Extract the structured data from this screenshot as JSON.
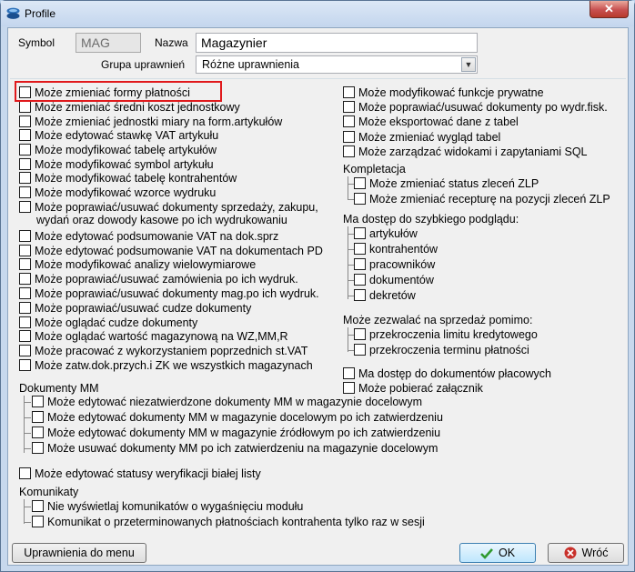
{
  "window": {
    "title": "Profile",
    "close_label": "✕"
  },
  "header": {
    "symbol_label": "Symbol",
    "symbol_value": "MAG",
    "name_label": "Nazwa",
    "name_value": "Magazynier",
    "group_label": "Grupa uprawnień",
    "group_value": "Różne uprawnienia"
  },
  "left_permissions": [
    "Może zmieniać formy płatności",
    "Może zmieniać średni koszt jednostkowy",
    "Może zmieniać jednostki miary na form.artykułów",
    "Może edytować stawkę VAT artykułu",
    "Może modyfikować tabelę artykułów",
    "Może modyfikować symbol artykułu",
    "Może modyfikować tabelę kontrahentów",
    "Może modyfikować wzorce wydruku",
    "Może poprawiać/usuwać dokumenty sprzedaży, zakupu,",
    "Może edytować podsumowanie VAT na dok.sprz",
    "Może edytować podsumowanie VAT na dokumentach PD",
    "Może modyfikować analizy wielowymiarowe",
    "Może poprawiać/usuwać zamówienia po ich wydruk.",
    "Może poprawiać/usuwać dokumenty mag.po ich wydruk.",
    "Może poprawiać/usuwać cudze dokumenty",
    "Może oglądać cudze dokumenty",
    "Może oglądać wartość magazynową na WZ,MM,R",
    "Może pracować z wykorzystaniem poprzednich st.VAT",
    "Może zatw.dok.przych.i ZK we wszystkich magazynach"
  ],
  "left_continuation": "wydań oraz dowody kasowe po ich wydrukowaniu",
  "dokumenty_mm": {
    "title": "Dokumenty MM",
    "items": [
      "Może edytować niezatwierdzone dokumenty MM w magazynie docelowym",
      "Może edytować dokumenty MM w magazynie docelowym po ich zatwierdzeniu",
      "Może edytować dokumenty MM w magazynie źródłowym po ich zatwierdzeniu",
      "Może usuwać dokumenty MM po ich zatwierdzeniu na magazynie docelowym"
    ]
  },
  "white_list": "Może edytować statusy weryfikacji białej listy",
  "komunikaty": {
    "title": "Komunikaty",
    "items": [
      "Nie wyświetlaj komunikatów o wygaśnięciu modułu",
      "Komunikat o przeterminowanych płatnościach kontrahenta tylko raz w sesji"
    ]
  },
  "right_permissions": [
    "Może modyfikować funkcje prywatne",
    "Może poprawiać/usuwać dokumenty po wydr.fisk.",
    "Może eksportować dane z tabel",
    "Może zmieniać wygląd tabel",
    "Może zarządzać widokami i zapytaniami SQL"
  ],
  "kompletacja": {
    "title": "Kompletacja",
    "items": [
      "Może zmieniać status zleceń ZLP",
      "Może zmieniać recepturę na pozycji zleceń ZLP"
    ]
  },
  "podglad": {
    "title": "Ma dostęp do szybkiego podglądu:",
    "items": [
      "artykułów",
      "kontrahentów",
      "pracowników",
      "dokumentów",
      "dekretów"
    ]
  },
  "sprzedaz": {
    "title": "Może zezwalać na sprzedaż pomimo:",
    "items": [
      "przekroczenia limitu kredytowego",
      "przekroczenia terminu płatności"
    ]
  },
  "right_bottom": [
    "Ma dostęp do dokumentów płacowych",
    "Może pobierać załącznik"
  ],
  "footer": {
    "menu_button": "Uprawnienia do menu",
    "ok_button": "OK",
    "cancel_button": "Wróć"
  },
  "colors": {
    "highlight": "#e0191c",
    "ok_check": "#2f9a2f",
    "cancel_x": "#c8302a"
  }
}
